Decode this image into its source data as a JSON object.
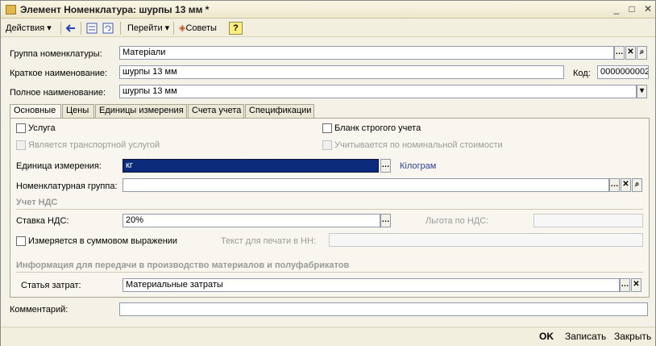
{
  "window": {
    "title": "Элемент Номенклатура: шурпы 13 мм *"
  },
  "toolbar": {
    "actions": "Действия",
    "goto": "Перейти",
    "tips": "Советы",
    "help": "?"
  },
  "form": {
    "group_label": "Группа номенклатуры:",
    "group_value": "Матеріали",
    "short_label": "Краткое наименование:",
    "short_value": "шурпы 13 мм",
    "code_label": "Код:",
    "code_value": "0000000002",
    "full_label": "Полное наименование:",
    "full_value": "шурпы 13 мм",
    "comment_label": "Комментарий:",
    "comment_value": ""
  },
  "tabs": [
    {
      "label": "Основные"
    },
    {
      "label": "Цены"
    },
    {
      "label": "Единицы измерения"
    },
    {
      "label": "Счета учета"
    },
    {
      "label": "Спецификации"
    }
  ],
  "main": {
    "service_label": "Услуга",
    "transport_label": "Является транспортной услугой",
    "strict_label": "Бланк строгого учета",
    "nominal_label": "Учитывается по номинальной стоимости",
    "unit_label": "Единица измерения:",
    "unit_value": "кг",
    "unit_link": "Кілограм",
    "nomgroup_label": "Номенклатурная группа:",
    "nomgroup_value": "",
    "vat_section": "Учет НДС",
    "vat_rate_label": "Ставка НДС:",
    "vat_rate_value": "20%",
    "vat_benefit_label": "Льгота по НДС:",
    "vat_benefit_value": "",
    "sum_measure_label": "Измеряется в суммовом выражении",
    "print_text_label": "Текст для печати в НН:",
    "print_text_value": "",
    "prod_section": "Информация для передачи в производство материалов и полуфабрикатов",
    "cost_label": "Статья затрат:",
    "cost_value": "Материальные затраты"
  },
  "footer": {
    "ok": "OK",
    "save": "Записать",
    "close": "Закрыть"
  }
}
